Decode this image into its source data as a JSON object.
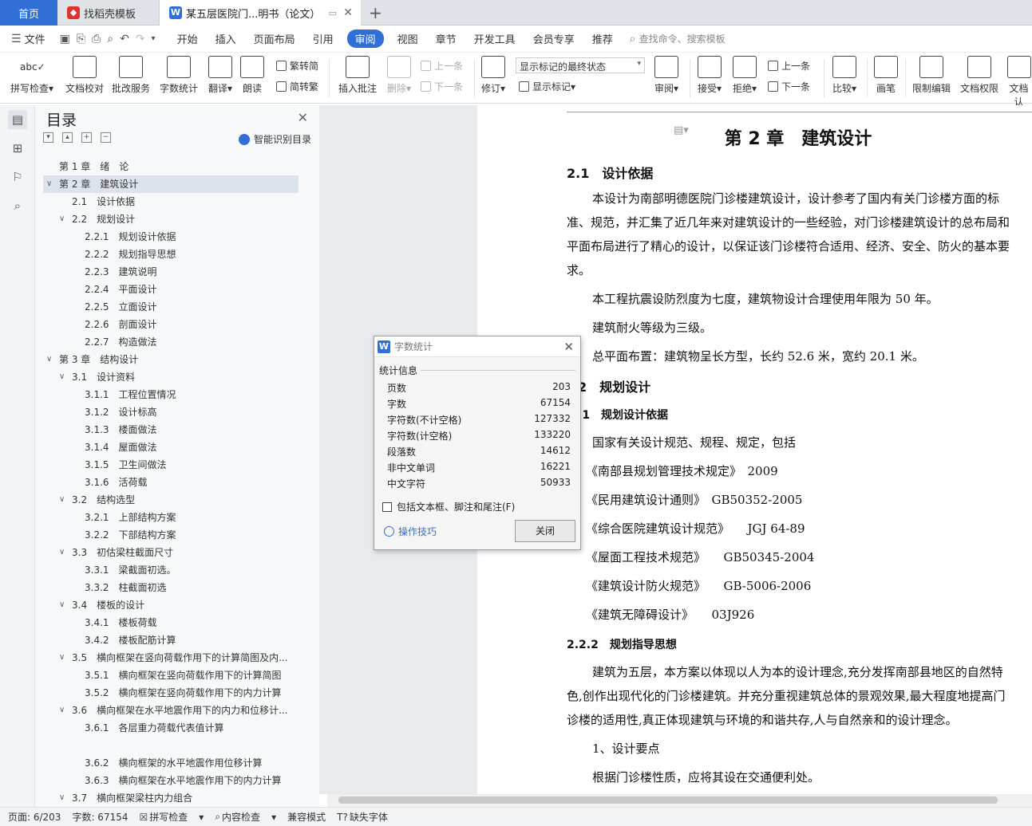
{
  "tabs": {
    "home": "首页",
    "t2": "找稻壳模板",
    "t3": "某五层医院门...明书（论文）"
  },
  "menu": {
    "file": "文件",
    "items": [
      "开始",
      "插入",
      "页面布局",
      "引用",
      "审阅",
      "视图",
      "章节",
      "开发工具",
      "会员专享",
      "推荐"
    ],
    "active": "审阅",
    "search": "查找命令、搜索模板"
  },
  "ribbon": {
    "spell": "拼写检查",
    "proof": "文档校对",
    "batch": "批改服务",
    "count": "字数统计",
    "translate": "翻译",
    "read": "朗读",
    "trad": "繁转简",
    "simp": "简转繁",
    "comment": "插入批注",
    "delete": "删除",
    "prev": "上一条",
    "next": "下一条",
    "revise": "修订",
    "markup_select": "显示标记的最终状态",
    "show_markup": "显示标记",
    "review": "审阅",
    "accept": "接受",
    "reject": "拒绝",
    "prev2": "上一条",
    "next2": "下一条",
    "compare": "比较",
    "pen": "画笔",
    "restrict": "限制编辑",
    "rights": "文档权限",
    "more": "文档认"
  },
  "toc": {
    "title": "目录",
    "smart": "智能识别目录",
    "items": [
      {
        "t": "第 1 章　绪　论",
        "lv": 0,
        "car": ""
      },
      {
        "t": "第 2 章　建筑设计",
        "lv": 0,
        "car": "v",
        "sel": true
      },
      {
        "t": "2.1　设计依据",
        "lv": 1,
        "car": ""
      },
      {
        "t": "2.2　规划设计",
        "lv": 1,
        "car": "v"
      },
      {
        "t": "2.2.1　规划设计依据",
        "lv": 2,
        "car": ""
      },
      {
        "t": "2.2.2　规划指导思想",
        "lv": 2,
        "car": ""
      },
      {
        "t": "2.2.3　建筑说明",
        "lv": 2,
        "car": ""
      },
      {
        "t": "2.2.4　平面设计",
        "lv": 2,
        "car": ""
      },
      {
        "t": "2.2.5　立面设计",
        "lv": 2,
        "car": ""
      },
      {
        "t": "2.2.6　剖面设计",
        "lv": 2,
        "car": ""
      },
      {
        "t": "2.2.7　构造做法",
        "lv": 2,
        "car": ""
      },
      {
        "t": "第 3 章　结构设计",
        "lv": 0,
        "car": "v"
      },
      {
        "t": "3.1　设计资料",
        "lv": 1,
        "car": "v"
      },
      {
        "t": "3.1.1　工程位置情况",
        "lv": 2,
        "car": ""
      },
      {
        "t": "3.1.2　设计标高",
        "lv": 2,
        "car": ""
      },
      {
        "t": "3.1.3　楼面做法",
        "lv": 2,
        "car": ""
      },
      {
        "t": "3.1.4　屋面做法",
        "lv": 2,
        "car": ""
      },
      {
        "t": "3.1.5　卫生间做法",
        "lv": 2,
        "car": ""
      },
      {
        "t": "3.1.6　活荷载",
        "lv": 2,
        "car": ""
      },
      {
        "t": "3.2　结构选型",
        "lv": 1,
        "car": "v"
      },
      {
        "t": "3.2.1　上部结构方案",
        "lv": 2,
        "car": ""
      },
      {
        "t": "3.2.2　下部结构方案",
        "lv": 2,
        "car": ""
      },
      {
        "t": "3.3　初估梁柱截面尺寸",
        "lv": 1,
        "car": "v"
      },
      {
        "t": "3.3.1　梁截面初选。",
        "lv": 2,
        "car": ""
      },
      {
        "t": "3.3.2　柱截面初选",
        "lv": 2,
        "car": ""
      },
      {
        "t": "3.4　楼板的设计",
        "lv": 1,
        "car": "v"
      },
      {
        "t": "3.4.1　楼板荷载",
        "lv": 2,
        "car": ""
      },
      {
        "t": "3.4.2　楼板配筋计算",
        "lv": 2,
        "car": ""
      },
      {
        "t": "3.5　横向框架在竖向荷载作用下的计算简图及内...",
        "lv": 1,
        "car": "v"
      },
      {
        "t": "3.5.1　横向框架在竖向荷载作用下的计算简图",
        "lv": 2,
        "car": ""
      },
      {
        "t": "3.5.2　横向框架在竖向荷载作用下的内力计算",
        "lv": 2,
        "car": ""
      },
      {
        "t": "3.6　横向框架在水平地震作用下的内力和位移计...",
        "lv": 1,
        "car": "v"
      },
      {
        "t": "3.6.1　各层重力荷载代表值计算",
        "lv": 2,
        "car": ""
      },
      {
        "t": "",
        "lv": 2,
        "car": ""
      },
      {
        "t": "3.6.2　横向框架的水平地震作用位移计算",
        "lv": 2,
        "car": ""
      },
      {
        "t": "3.6.3　横向框架在水平地震作用下的内力计算",
        "lv": 2,
        "car": ""
      },
      {
        "t": "3.7　横向框架梁柱内力组合",
        "lv": 1,
        "car": "v"
      }
    ]
  },
  "doc": {
    "h1": "第 2 章　建筑设计",
    "h2a": "2.1　设计依据",
    "p1": "本设计为南部明德医院门诊楼建筑设计，设计参考了国内有关门诊楼方面的标",
    "p1b": "准、规范，并汇集了近几年来对建筑设计的一些经验，对门诊楼建筑设计的总布局和",
    "p1c": "平面布局进行了精心的设计，以保证该门诊楼符合适用、经济、安全、防火的基本要",
    "p1d": "求。",
    "p2": "本工程抗震设防烈度为七度，建筑物设计合理使用年限为 50 年。",
    "p3": "建筑耐火等级为三级。",
    "p4": "总平面布置：建筑物呈长方型，长约 52.6 米，宽约 20.1 米。",
    "h2b": "2　规划设计",
    "h3a": ".1　规划设计依据",
    "p5": "国家有关设计规范、规程、规定，包括",
    "l1": "《南部县规划管理技术规定》　2009",
    "l2": "《民用建筑设计通则》　GB50352-2005",
    "l3": "《综合医院建筑设计规范》　　JGJ 64-89",
    "l4": "《屋面工程技术规范》　　GB50345-2004",
    "l5": "《建筑设计防火规范》　　GB-5006-2006",
    "l6": "《建筑无障碍设计》　　03J926",
    "h3b": "2.2.2　规划指导思想",
    "p6": "建筑为五层，本方案以体现以人为本的设计理念,充分发挥南部县地区的自然特",
    "p6b": "色,创作出现代化的门诊楼建筑。并充分重视建筑总体的景观效果,最大程度地提高门",
    "p6c": "诊楼的适用性,真正体现建筑与环境的和谐共存,人与自然亲和的设计理念。",
    "p7": "1、设计要点",
    "p8": "根据门诊楼性质，应将其设在交通便利处。"
  },
  "dialog": {
    "title": "字数统计",
    "group": "统计信息",
    "rows": [
      {
        "k": "页数",
        "v": "203"
      },
      {
        "k": "字数",
        "v": "67154"
      },
      {
        "k": "字符数(不计空格)",
        "v": "127332"
      },
      {
        "k": "字符数(计空格)",
        "v": "133220"
      },
      {
        "k": "段落数",
        "v": "14612"
      },
      {
        "k": "非中文单词",
        "v": "16221"
      },
      {
        "k": "中文字符",
        "v": "50933"
      }
    ],
    "check": "包括文本框、脚注和尾注(F)",
    "tips": "操作技巧",
    "close": "关闭"
  },
  "status": {
    "page": "页面: 6/203",
    "words": "字数: 67154",
    "spell": "拼写检查",
    "content": "内容检查",
    "compat": "兼容模式",
    "font": "缺失字体"
  }
}
